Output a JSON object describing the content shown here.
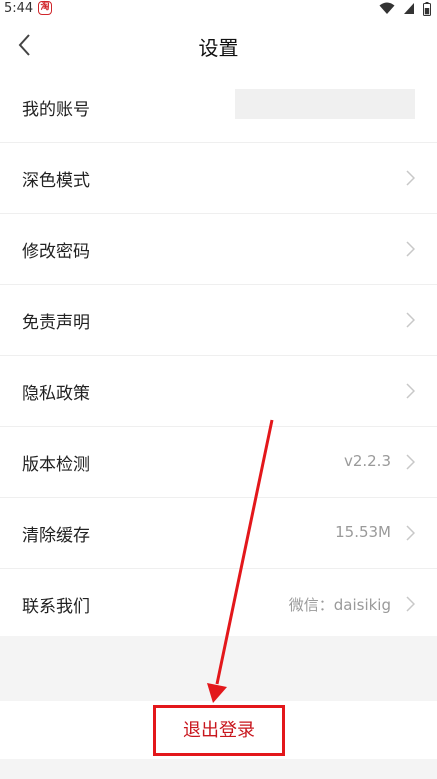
{
  "status_bar": {
    "time": "5:44",
    "app_badge": "淘",
    "icons": [
      "wifi-icon",
      "signal-icon",
      "battery-icon"
    ]
  },
  "header": {
    "title": "设置",
    "back_icon": "back-chevron-icon"
  },
  "settings": [
    {
      "label": "我的账号",
      "value": ""
    },
    {
      "label": "深色模式",
      "value": ""
    },
    {
      "label": "修改密码",
      "value": ""
    },
    {
      "label": "免责声明",
      "value": ""
    },
    {
      "label": "隐私政策",
      "value": ""
    },
    {
      "label": "版本检测",
      "value": "v2.2.3"
    },
    {
      "label": "清除缓存",
      "value": "15.53M"
    },
    {
      "label": "联系我们",
      "value": "微信：daisikig"
    }
  ],
  "logout": {
    "label": "退出登录"
  },
  "colors": {
    "accent_red": "#e3171b",
    "logout_text": "#c8161d",
    "muted_text": "#9a9a9a",
    "page_background": "#f4f4f4"
  }
}
